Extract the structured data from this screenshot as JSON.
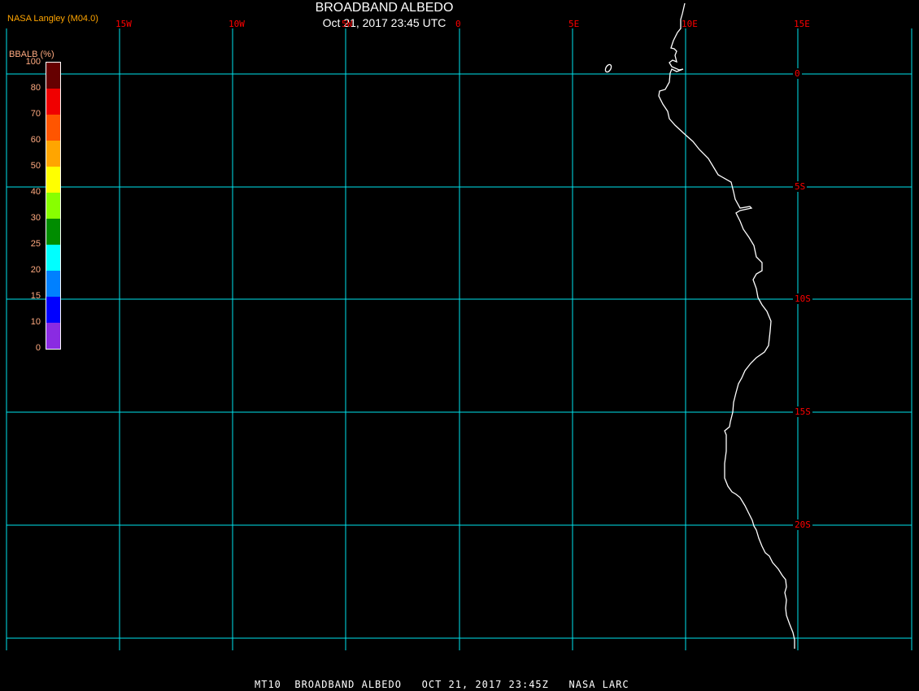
{
  "header": {
    "title": "BROADBAND ALBEDO",
    "subtitle": "Oct 21, 2017 23:45 UTC",
    "credit": "NASA Langley (M04.0)"
  },
  "colorbar": {
    "title": "BBALB (%)",
    "labels": [
      "100",
      "80",
      "70",
      "60",
      "50",
      "40",
      "30",
      "25",
      "20",
      "15",
      "10",
      "0"
    ],
    "colors": [
      "#660000",
      "#f00000",
      "#ff5500",
      "#ffa500",
      "#ffff00",
      "#88ff00",
      "#008c00",
      "#00ffff",
      "#0080ff",
      "#0000ff",
      "#8a2be2"
    ]
  },
  "map": {
    "grid_color": "#00e5ee",
    "coastline_color": "#ffffff",
    "lon_labels": [
      "15W",
      "10W",
      "5W",
      "0",
      "5E",
      "10E",
      "15E"
    ],
    "lat_labels": [
      "0",
      "5S",
      "10S",
      "15S",
      "20S"
    ]
  },
  "footer": {
    "text": "MT10  BROADBAND ALBEDO   OCT 21, 2017 23:45Z   NASA LARC"
  }
}
